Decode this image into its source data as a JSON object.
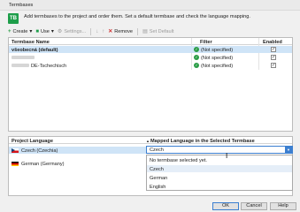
{
  "window": {
    "title": "Termbases"
  },
  "header": {
    "icon_text": "TB",
    "description": "Add termbases to the project and order them. Set a default termbase and check the language mapping."
  },
  "toolbar": {
    "create": "Create",
    "use": "Use",
    "settings": "Settings...",
    "remove": "Remove",
    "set_default": "Set Default"
  },
  "termbase_table": {
    "columns": {
      "name": "Termbase Name",
      "filter": "Filter",
      "enabled": "Enabled"
    },
    "rows": [
      {
        "name": "všeobecná (default)",
        "filter": "(Not specified)",
        "enabled": true
      },
      {
        "name": "",
        "filter": "(Not specified)",
        "enabled": true
      },
      {
        "name": "DE-Tschechisch",
        "filter": "(Not specified)",
        "enabled": true
      }
    ]
  },
  "language_table": {
    "columns": {
      "project": "Project Language",
      "mapped": "Mapped Language in the Selected Termbase"
    },
    "rows": [
      {
        "language": "Czech (Czechia)",
        "flag": "czech-flag"
      },
      {
        "language": "German (Germany)",
        "flag": "german-flag"
      }
    ],
    "combo_value": "Czech",
    "dropdown_options": [
      "No termbase selected yet.",
      "Czech",
      "German",
      "English"
    ]
  },
  "buttons": {
    "ok": "OK",
    "cancel": "Cancel",
    "help": "Help"
  },
  "colors": {
    "accent": "#3c7fd0",
    "selected_row": "#cfe4f7",
    "ok_green": "#2a9c46"
  }
}
